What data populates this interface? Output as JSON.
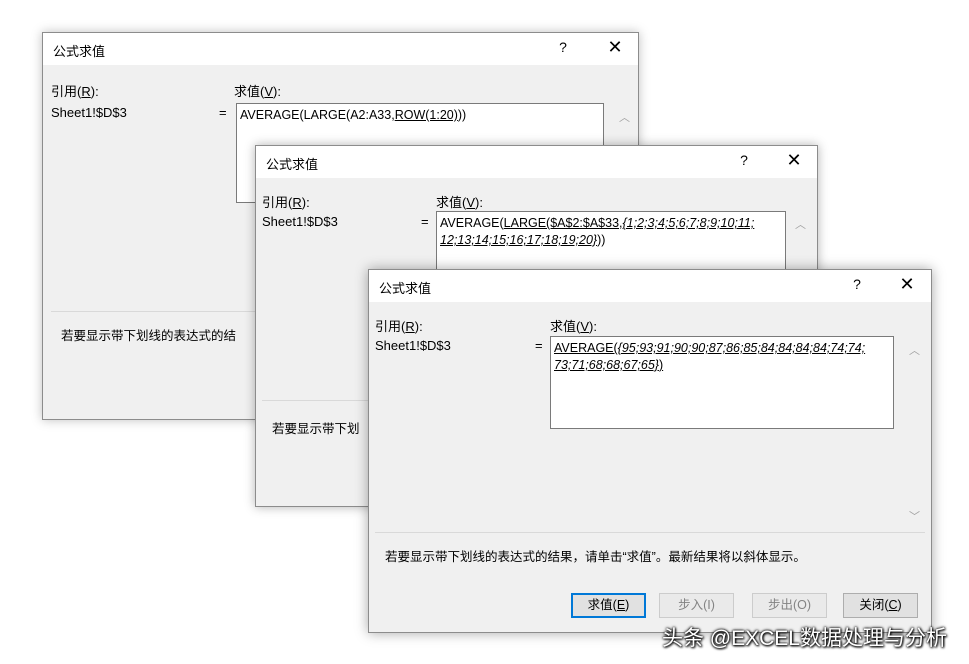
{
  "dialogs": [
    {
      "title": "公式求值",
      "help": "?",
      "close": "✕",
      "ref_label": "引用",
      "ref_key": "R",
      "ref_value": "Sheet1!$D$3",
      "eval_label": "求值",
      "eval_key": "V",
      "equals": "=",
      "expr": {
        "a": "AVERAGE(LARGE(A2:A33,",
        "b": "ROW(1:20)",
        "c": "))"
      },
      "hint": "若要显示带下划线的表达式的结"
    },
    {
      "title": "公式求值",
      "help": "?",
      "close": "✕",
      "ref_label": "引用",
      "ref_key": "R",
      "ref_value": "Sheet1!$D$3",
      "eval_label": "求值",
      "eval_key": "V",
      "equals": "=",
      "expr": {
        "a": "AVERAGE(",
        "b": "LARGE($A$2:$A$33,",
        "c": "{1;2;3;4;5;6;7;8;9;10;11;",
        "d": "12;13;14;15;16;17;18;19;20}",
        "e": "))"
      },
      "hint": "若要显示带下划"
    },
    {
      "title": "公式求值",
      "help": "?",
      "close": "✕",
      "ref_label": "引用",
      "ref_key": "R",
      "ref_value": "Sheet1!$D$3",
      "eval_label": "求值",
      "eval_key": "V",
      "equals": "=",
      "expr": {
        "a": "AVERAGE(",
        "b": "{95;93;91;90;90;87;86;85;84;84;84;84;74;74;",
        "c": "73;71;68;68;67;65}",
        "d": ")"
      },
      "hint": "若要显示带下划线的表达式的结果，请单击“求值”。最新结果将以斜体显示。",
      "buttons": {
        "evaluate": "求值(",
        "evaluate_key": "E",
        "evaluate_end": ")",
        "step_in": "步入(I)",
        "step_out": "步出(O)",
        "close": "关闭(",
        "close_key": "C",
        "close_end": ")"
      }
    }
  ],
  "watermark": "头条 @EXCEL数据处理与分析"
}
